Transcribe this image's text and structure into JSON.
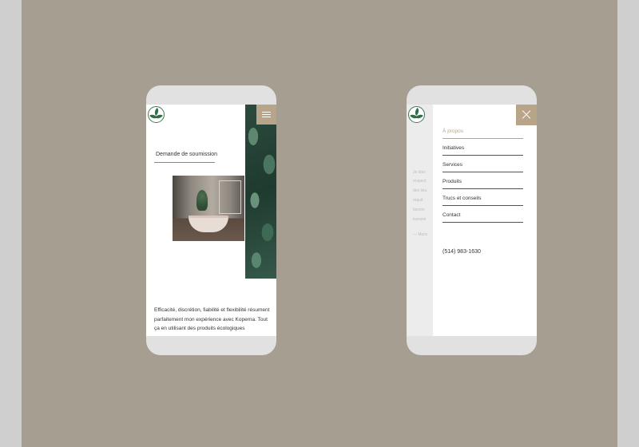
{
  "colors": {
    "background": "#a79e92",
    "accent": "#b8a489",
    "logo_green": "#2f6e46"
  },
  "left_phone": {
    "logo_icon": "leaf-logo",
    "menu_icon": "hamburger-icon",
    "cta_label": "Demande de soumission",
    "photo_icon": "bathroom-photo",
    "body_text": "Efficacité, discrétion, fiabilité et flexibilité résument parfaitement mon expérience avec Koperna. Tout ça en utilisant des produits écologiques"
  },
  "right_phone": {
    "logo_icon": "leaf-logo",
    "close_icon": "close-icon",
    "background_text": [
      "Je dois",
      "respect",
      "des lieu",
      "requit",
      "favoris",
      "transmi",
      "— Mura"
    ],
    "nav": [
      {
        "label": "À propos",
        "active": true
      },
      {
        "label": "Initiatives",
        "active": false
      },
      {
        "label": "Services",
        "active": false
      },
      {
        "label": "Produits",
        "active": false
      },
      {
        "label": "Trucs et conseils",
        "active": false
      },
      {
        "label": "Contact",
        "active": false
      }
    ],
    "phone": "(514) 983-1630"
  }
}
